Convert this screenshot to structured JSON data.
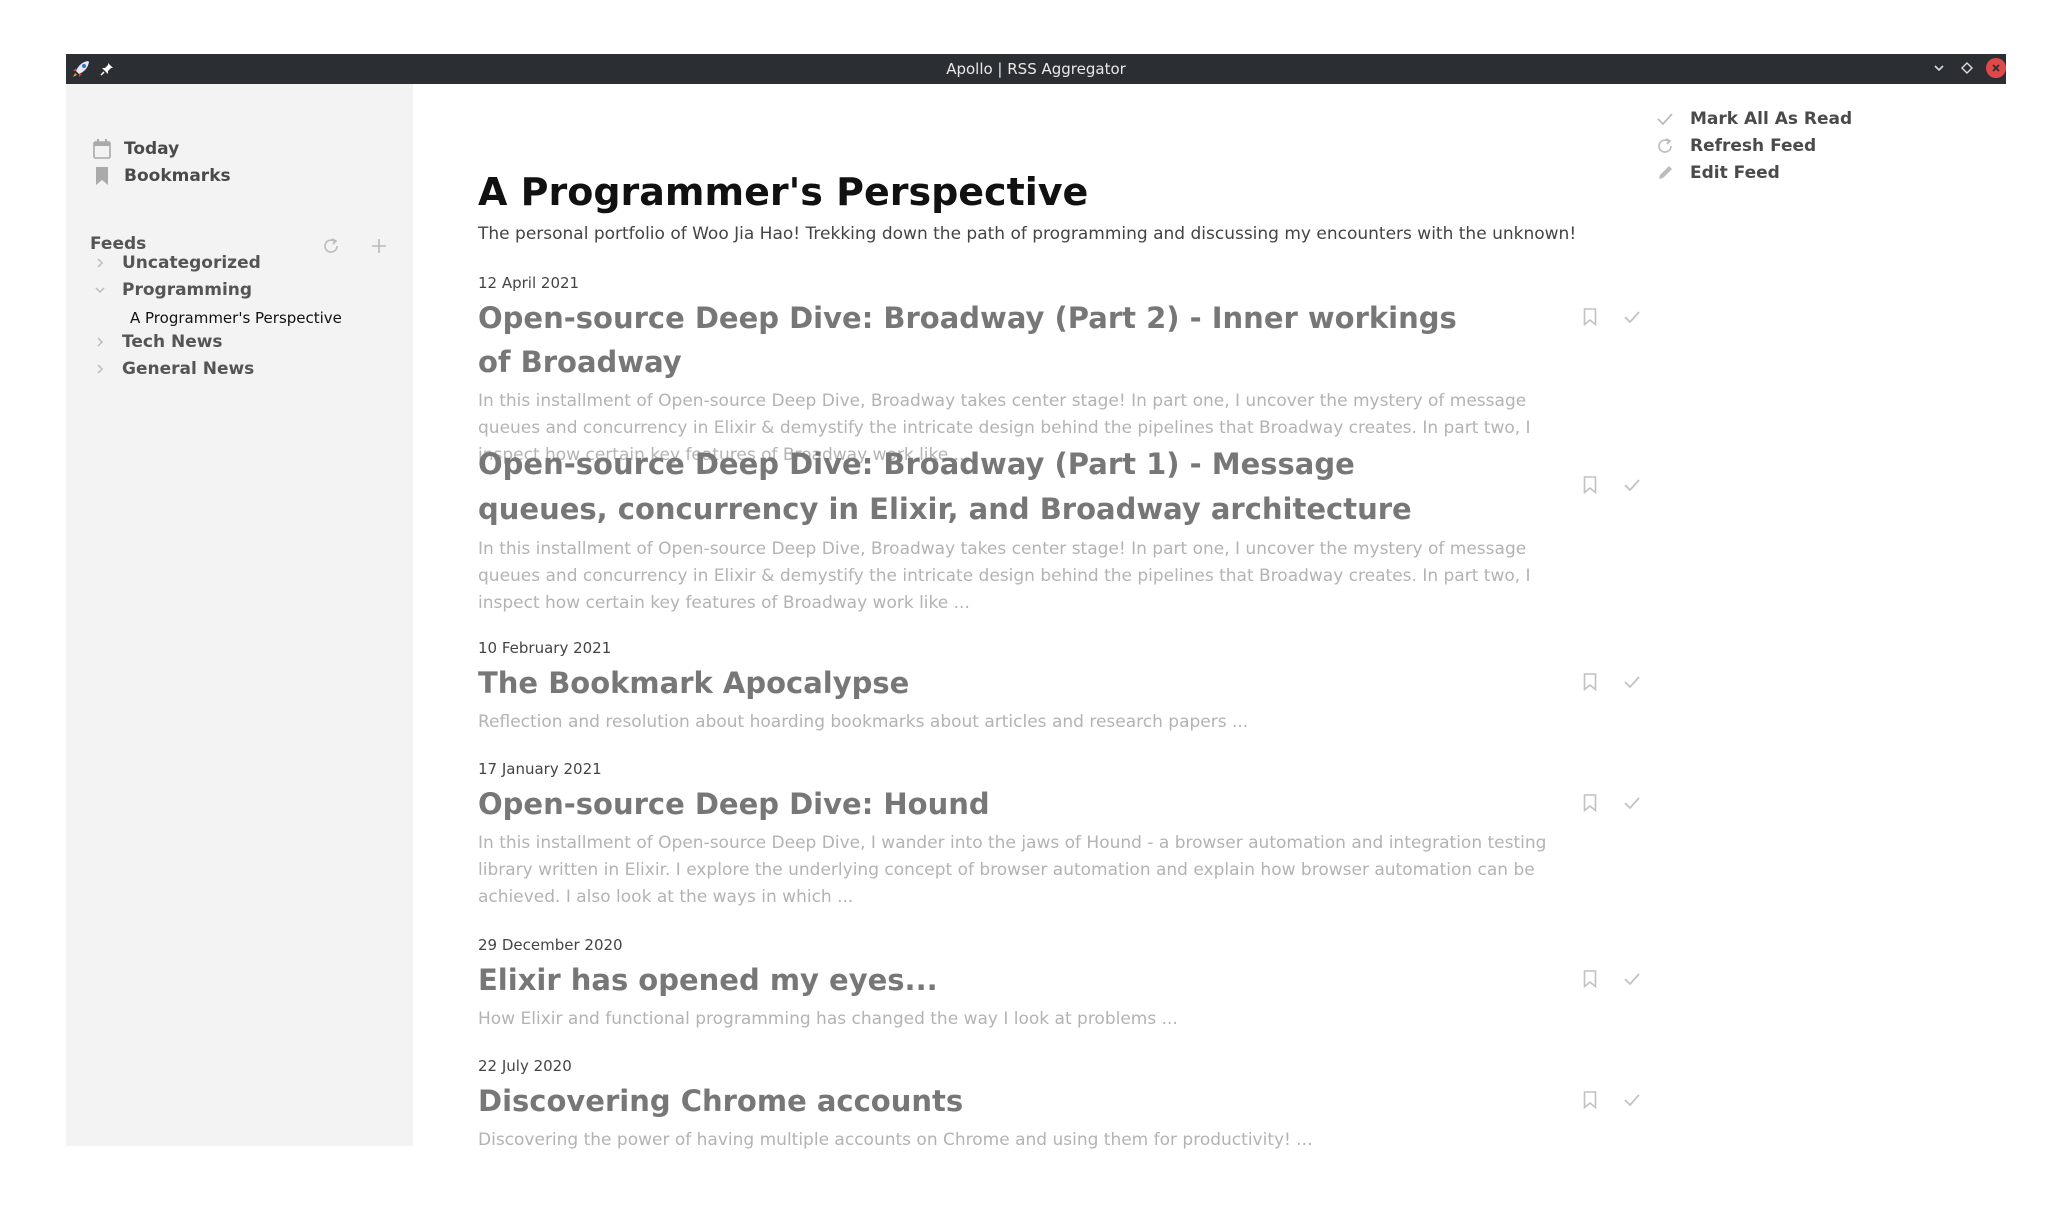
{
  "window": {
    "title": "Apollo | RSS Aggregator",
    "colors": {
      "titlebar": "#2b2e33",
      "close": "#e0494a",
      "sidebar": "#f3f3f3"
    }
  },
  "sidebar": {
    "nav": [
      {
        "label": "Today",
        "icon": "calendar-icon"
      },
      {
        "label": "Bookmarks",
        "icon": "bookmark-icon"
      }
    ],
    "feeds_label": "Feeds",
    "tree": [
      {
        "label": "Uncategorized",
        "expanded": false
      },
      {
        "label": "Programming",
        "expanded": true,
        "children": [
          "A Programmer's Perspective"
        ]
      },
      {
        "label": "Tech News",
        "expanded": false
      },
      {
        "label": "General News",
        "expanded": false
      }
    ]
  },
  "feed": {
    "title": "A Programmer's Perspective",
    "description": "The personal portfolio of Woo Jia Hao! Trekking down the path of programming and discussing my encounters with the unknown!"
  },
  "articles": [
    {
      "date": "12 April 2021",
      "title": "Open-source Deep Dive: Broadway (Part 2) - Inner workings of Broadway",
      "summary": "In this installment of Open-source Deep Dive, Broadway takes center stage! In part one, I uncover the mystery of message queues and concurrency in Elixir & demystify the intricate design behind the pipelines that Broadway creates. In part two, I inspect how certain key features of Broadway work like ..."
    },
    {
      "date": "",
      "title": "Open-source Deep Dive: Broadway (Part 1) - Message queues, concurrency in Elixir, and Broadway architecture",
      "summary": "In this installment of Open-source Deep Dive, Broadway takes center stage! In part one, I uncover the mystery of message queues and concurrency in Elixir & demystify the intricate design behind the pipelines that Broadway creates. In part two, I inspect how certain key features of Broadway work like ..."
    },
    {
      "date": "10 February 2021",
      "title": "The Bookmark Apocalypse",
      "summary": "Reflection and resolution about hoarding bookmarks about articles and research papers ..."
    },
    {
      "date": "17 January 2021",
      "title": "Open-source Deep Dive: Hound",
      "summary": "In this installment of Open-source Deep Dive, I wander into the jaws of Hound - a browser automation and integration testing library written in Elixir. I explore the underlying concept of browser automation and explain how browser automation can be achieved. I also look at the ways in which ..."
    },
    {
      "date": "29 December 2020",
      "title": "Elixir has opened my eyes...",
      "summary": "How Elixir and functional programming has changed the way I look at problems ..."
    },
    {
      "date": "22 July 2020",
      "title": "Discovering Chrome accounts",
      "summary": "Discovering the power of having multiple accounts on Chrome and using them for productivity! ..."
    }
  ],
  "actions": {
    "mark_all_read": "Mark All As Read",
    "refresh_feed": "Refresh Feed",
    "edit_feed": "Edit Feed"
  }
}
